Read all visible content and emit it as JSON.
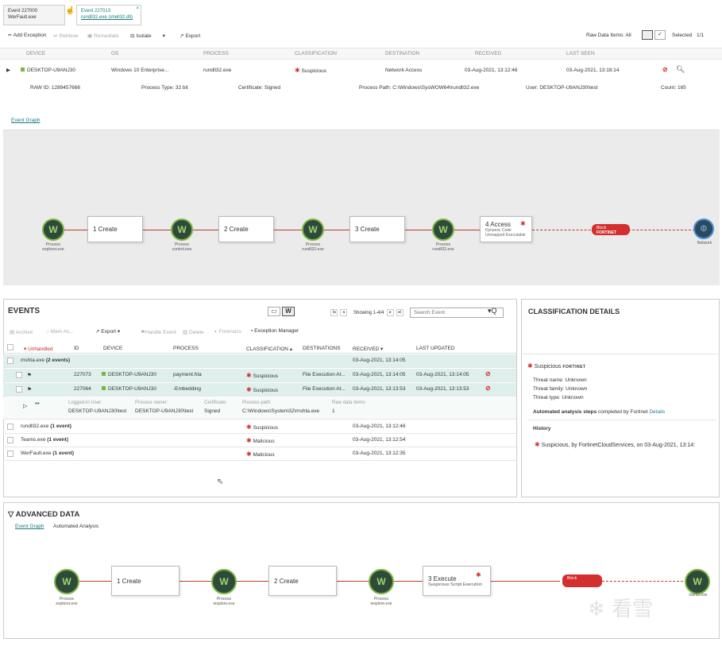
{
  "tabs": [
    {
      "title": "Event 227000",
      "subtitle": "WerFault.exe"
    },
    {
      "title": "Event 227013",
      "subtitle": "rundll32.exe (shell32.dll)"
    }
  ],
  "toolbar": {
    "add_exception": "Add Exception",
    "retrieve": "Retrieve",
    "remediate": "Remediate",
    "isolate": "Isolate",
    "export": "Export",
    "raw_data_items": "Raw Data Items: All",
    "selected": "Selected",
    "page": "1/1"
  },
  "event_header": {
    "columns": [
      "DEVICE",
      "OS",
      "PROCESS",
      "CLASSIFICATION",
      "DESTINATION",
      "RECEIVED",
      "LAST SEEN"
    ],
    "row": {
      "device": "DESKTOP-U9ANJ30",
      "os": "Windows 10 Enterprise...",
      "process": "rundll32.exe",
      "classification": "Suspicious",
      "destination": "Network Access",
      "received": "03-Aug-2021, 13:12:46",
      "last_seen": "03-Aug-2021, 13:18:14"
    },
    "detail": {
      "raw_id": "RAW ID: 1289457666",
      "process_type": "Process Type: 32 bit",
      "certificate": "Certificate: Signed",
      "process_path": "Process Path: C:\\Windows\\SysWOW64\\rundll32.exe",
      "user": "User: DESKTOP-U9ANJ30\\test",
      "count": "Count: 165"
    }
  },
  "event_graph_tab": "Event Graph",
  "graph1": {
    "nodes": [
      {
        "label1": "Process",
        "label2": "explorer.exe"
      },
      {
        "label1": "Process",
        "label2": "control.exe"
      },
      {
        "label1": "Process",
        "label2": "rundll32.exe"
      },
      {
        "label1": "Process",
        "label2": "rundll32.exe"
      }
    ],
    "steps": [
      "1 Create",
      "2 Create",
      "3 Create"
    ],
    "access": {
      "title": "4 Access",
      "sub1": "Dynamic Code",
      "sub2": "Unmapped Executable"
    },
    "block": {
      "label": "Block",
      "brand": "FORTINET"
    },
    "network": "Network"
  },
  "events": {
    "title": "EVENTS",
    "showing": "Showing 1-4/4",
    "search_placeholder": "Search Event",
    "toolbar": [
      "Archive",
      "Mark As...",
      "Export",
      "Handle Event",
      "Delete",
      "Forensics",
      "Exception Manager"
    ],
    "columns": [
      "Unhandled",
      "ID",
      "DEVICE",
      "PROCESS",
      "CLASSIFICATION",
      "DESTINATIONS",
      "RECEIVED",
      "LAST UPDATED"
    ],
    "group1": {
      "name": "mshta.exe",
      "count": "(2 events)",
      "received": "03-Aug-2021, 13:14:05"
    },
    "rows": [
      {
        "id": "227073",
        "device": "DESKTOP-U9ANJ30",
        "process": "payment.hta",
        "classification": "Suspicious",
        "destination": "File Execution At...",
        "received": "03-Aug-2021, 13:14:05",
        "updated": "03-Aug-2021, 13:14:05"
      },
      {
        "id": "227064",
        "device": "DESKTOP-U9ANJ30",
        "process": "-Embedding",
        "classification": "Suspicious",
        "destination": "File Execution At...",
        "received": "03-Aug-2021, 13:13:53",
        "updated": "03-Aug-2021, 13:13:53"
      }
    ],
    "detail": {
      "logged_label": "Logged-in User:",
      "logged": "DESKTOP-U9ANJ30\\test",
      "owner_label": "Process owner:",
      "owner": "DESKTOP-U9ANJ30\\test",
      "cert_label": "Certificate:",
      "cert": "Signed",
      "path_label": "Process path:",
      "path": "C:\\Windows\\System32\\mshta.exe",
      "raw_label": "Raw data items:",
      "raw": "1"
    },
    "groups": [
      {
        "name": "rundll32.exe",
        "count": "(1 event)",
        "classification": "Suspicious",
        "received": "03-Aug-2021, 13:12:46"
      },
      {
        "name": "Teams.exe",
        "count": "(1 event)",
        "classification": "Malicious",
        "received": "03-Aug-2021, 13:12:54"
      },
      {
        "name": "WerFault.exe",
        "count": "(1 event)",
        "classification": "Malicious",
        "received": "03-Aug-2021, 13:12:35"
      }
    ]
  },
  "classification": {
    "title": "CLASSIFICATION DETAILS",
    "status": "Suspicious",
    "brand": "FORTINET",
    "threat_name": "Threat name: Unknown",
    "threat_family": "Threat family: Unknown",
    "threat_type": "Threat type: Unknown",
    "auto_bold": "Automated analysis steps",
    "auto_rest": "completed by Fortinet",
    "details_link": "Details",
    "history_title": "History",
    "history_item": "Suspicious, by FortinetCloudServices, on 03-Aug-2021, 13:14:"
  },
  "advanced": {
    "title": "ADVANCED DATA",
    "tab1": "Event Graph",
    "tab2": "Automated Analysis",
    "nodes": [
      {
        "label1": "Process",
        "label2": "explorer.exe"
      },
      {
        "label1": "Process",
        "label2": "iexplore.exe"
      },
      {
        "label1": "Process",
        "label2": "iexplore.exe"
      },
      {
        "label1": "",
        "label2": "mshta.exe"
      }
    ],
    "steps": [
      "1 Create",
      "2 Create"
    ],
    "execute": {
      "title": "3 Execute",
      "sub": "Suspicious Script Execution"
    },
    "block": "Block",
    "watermark": "看雪"
  },
  "colors": {
    "accent": "#1a7a7a",
    "danger": "#d32f2f",
    "node": "#2e4a3a",
    "highlight": "#dff0ec"
  }
}
